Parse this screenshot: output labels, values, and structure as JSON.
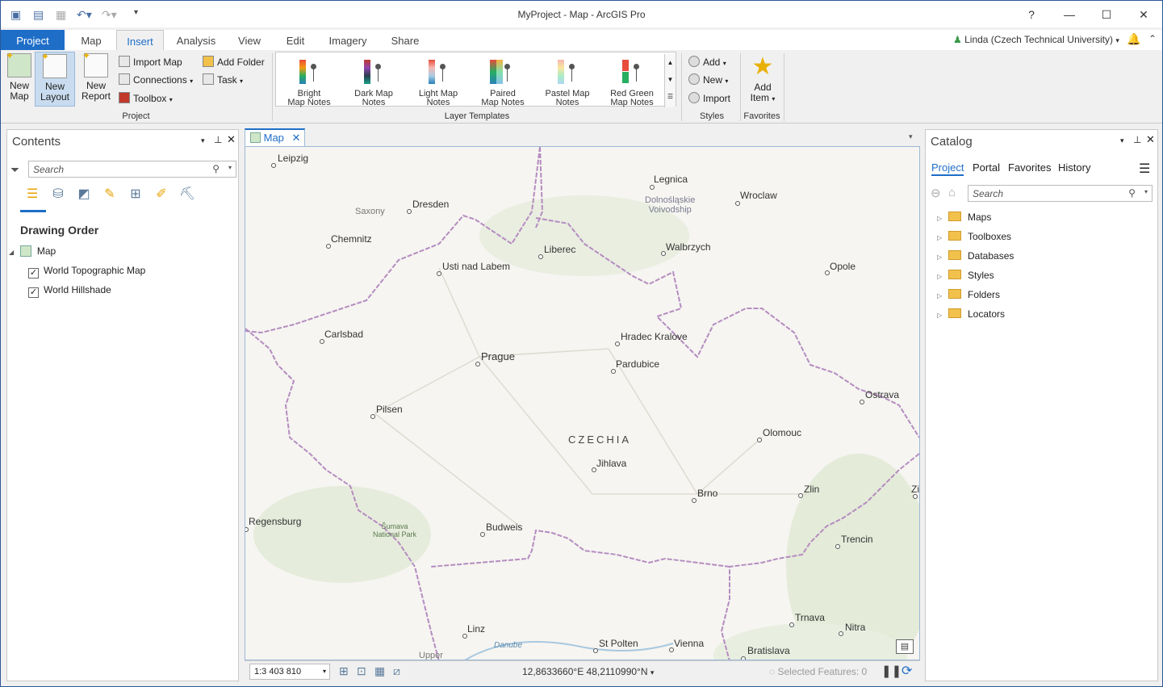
{
  "window": {
    "title": "MyProject - Map - ArcGIS Pro",
    "help": "?",
    "minimize": "—",
    "maximize": "☐",
    "close": "✕"
  },
  "qat": {
    "icons": [
      "new-project-icon",
      "open-project-icon",
      "save-project-icon",
      "undo-icon",
      "redo-icon",
      "customize-qat-icon"
    ]
  },
  "tabs": [
    {
      "label": "Project"
    },
    {
      "label": "Map"
    },
    {
      "label": "Insert"
    },
    {
      "label": "Analysis"
    },
    {
      "label": "View"
    },
    {
      "label": "Edit"
    },
    {
      "label": "Imagery"
    },
    {
      "label": "Share"
    }
  ],
  "user": {
    "name": "Linda (Czech Technical University)"
  },
  "ribbon": {
    "project_group": {
      "label": "Project",
      "new_map": "New\nMap",
      "new_layout": "New\nLayout",
      "new_report": "New\nReport",
      "import_map": "Import Map",
      "add_folder": "Add Folder",
      "connections": "Connections",
      "task": "Task",
      "toolbox": "Toolbox"
    },
    "templates_group": {
      "label": "Layer Templates",
      "items": [
        {
          "l1": "Bright",
          "l2": "Map Notes"
        },
        {
          "l1": "Dark Map",
          "l2": "Notes"
        },
        {
          "l1": "Light Map",
          "l2": "Notes"
        },
        {
          "l1": "Paired",
          "l2": "Map Notes"
        },
        {
          "l1": "Pastel Map",
          "l2": "Notes"
        },
        {
          "l1": "Red Green",
          "l2": "Map Notes"
        }
      ]
    },
    "styles_group": {
      "label": "Styles",
      "add": "Add",
      "new": "New",
      "import": "Import"
    },
    "favorites_group": {
      "label": "Favorites",
      "add_item_l1": "Add",
      "add_item_l2": "Item"
    }
  },
  "contents": {
    "title": "Contents",
    "search_placeholder": "Search",
    "drawing_order": "Drawing Order",
    "map": "Map",
    "layers": [
      {
        "name": "World Topographic Map",
        "checked": true
      },
      {
        "name": "World Hillshade",
        "checked": true
      }
    ]
  },
  "map_tab": {
    "label": "Map"
  },
  "map": {
    "country": "CZECHIA",
    "region": {
      "l1": "Dolnośląskie",
      "l2": "Voivodship"
    },
    "saxony": "Saxony",
    "park": {
      "l1": "Šumava",
      "l2": "National Park"
    },
    "danube": "Danube",
    "upper": "Upper",
    "cities": [
      {
        "name": "Leipzig"
      },
      {
        "name": "Legnica"
      },
      {
        "name": "Wroclaw"
      },
      {
        "name": "Dresden"
      },
      {
        "name": "Chemnitz"
      },
      {
        "name": "Liberec"
      },
      {
        "name": "Walbrzych"
      },
      {
        "name": "Usti nad Labem"
      },
      {
        "name": "Opole"
      },
      {
        "name": "Carlsbad"
      },
      {
        "name": "Hradec Kralove"
      },
      {
        "name": "Prague"
      },
      {
        "name": "Pardubice"
      },
      {
        "name": "Ostrava"
      },
      {
        "name": "Pilsen"
      },
      {
        "name": "Olomouc"
      },
      {
        "name": "Jihlava"
      },
      {
        "name": "Zlin"
      },
      {
        "name": "Zi"
      },
      {
        "name": "Brno"
      },
      {
        "name": "Regensburg"
      },
      {
        "name": "Budweis"
      },
      {
        "name": "Trencin"
      },
      {
        "name": "Trnava"
      },
      {
        "name": "Nitra"
      },
      {
        "name": "Linz"
      },
      {
        "name": "St Polten"
      },
      {
        "name": "Vienna"
      },
      {
        "name": "Bratislava"
      }
    ]
  },
  "status": {
    "scale": "1:3 403 810",
    "coords": "12,8633660°E 48,2110990°N",
    "selected": "Selected Features: 0"
  },
  "catalog": {
    "title": "Catalog",
    "tabs": [
      {
        "label": "Project"
      },
      {
        "label": "Portal"
      },
      {
        "label": "Favorites"
      },
      {
        "label": "History"
      }
    ],
    "search_placeholder": "Search",
    "items": [
      {
        "label": "Maps"
      },
      {
        "label": "Toolboxes"
      },
      {
        "label": "Databases"
      },
      {
        "label": "Styles"
      },
      {
        "label": "Folders"
      },
      {
        "label": "Locators"
      }
    ]
  },
  "colors": {
    "accent": "#1e6ec8",
    "border": "#2b5797",
    "boundary": "#b58cc0"
  }
}
